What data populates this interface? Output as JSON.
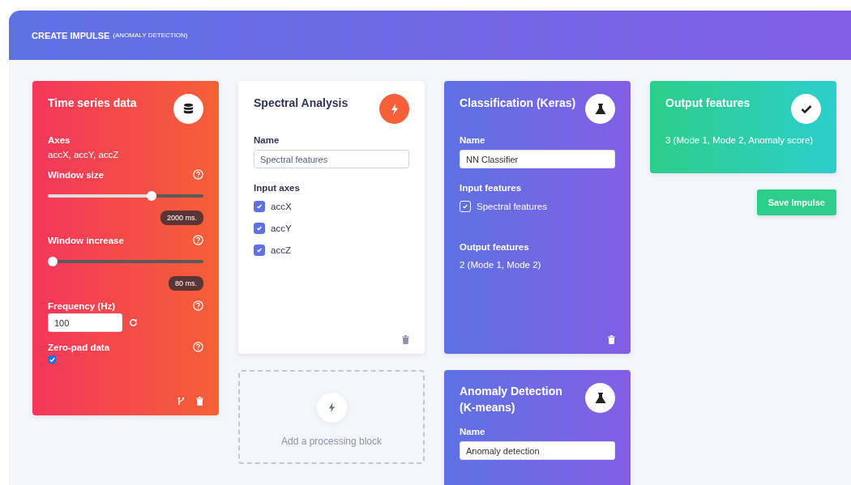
{
  "header": {
    "title": "CREATE IMPULSE",
    "subtitle": "(ANOMALY DETECTION)"
  },
  "time_series": {
    "title": "Time series data",
    "axes_label": "Axes",
    "axes_value": "accX, accY, accZ",
    "sliders": [
      {
        "label": "Window size",
        "level": 0.68,
        "reading": "2000 ms."
      },
      {
        "label": "Window increase",
        "level": 0,
        "reading": "80 ms."
      }
    ],
    "frequency": {
      "label": "Frequency (Hz)",
      "value": "100"
    },
    "zero_pad": {
      "label": "Zero-pad data",
      "checked": true
    }
  },
  "spectral": {
    "title": "Spectral Analysis",
    "name_label": "Name",
    "name_value": "Spectral features",
    "input_label": "Input axes",
    "axes": [
      {
        "label": "accX",
        "checked": true
      },
      {
        "label": "accY",
        "checked": true
      },
      {
        "label": "accZ",
        "checked": true
      }
    ]
  },
  "add_block": {
    "label": "Add a processing block"
  },
  "classification": {
    "title": "Classification (Keras)",
    "name_label": "Name",
    "name_value": "NN Classifier",
    "input_label": "Input features",
    "inputs": [
      {
        "label": "Spectral features",
        "checked": true
      }
    ],
    "output_label": "Output features",
    "output_value": "2 (Mode 1, Mode 2)"
  },
  "anomaly": {
    "title": "Anomaly Detection (K-means)",
    "name_label": "Name",
    "name_value": "Anomaly detection"
  },
  "output": {
    "title": "Output features",
    "value": "3 (Mode 1, Mode 2, Anomaly score)"
  },
  "save_button": "Save Impulse"
}
